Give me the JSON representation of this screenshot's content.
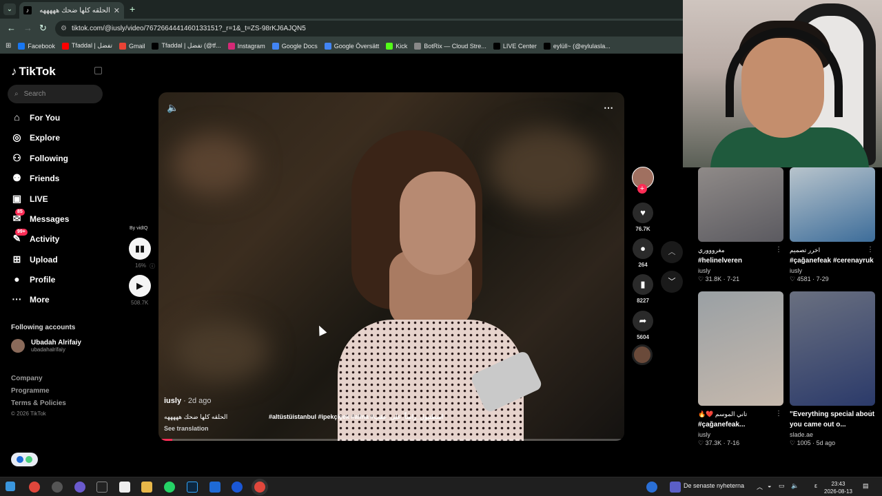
{
  "browser": {
    "tab_title": "الحلقه كلها ضحك هههههه",
    "tab_favicon": "♪",
    "new_tab": "+",
    "url": "tiktok.com/@iusly/video/7672664441460133151?_r=1&_t=ZS-98rKJ6AJQN5",
    "bookmarks": [
      {
        "label": "Facebook",
        "color": "#1877f2"
      },
      {
        "label": "Tfaddal | تفضل",
        "color": "#ff0000"
      },
      {
        "label": "Gmail",
        "color": "#ea4335"
      },
      {
        "label": "Tfaddal | تفضل (@tf...",
        "color": "#000000"
      },
      {
        "label": "Instagram",
        "color": "#d62976"
      },
      {
        "label": "Google Docs",
        "color": "#4285f4"
      },
      {
        "label": "Google Översätt",
        "color": "#4285f4"
      },
      {
        "label": "Kick",
        "color": "#53fc18"
      },
      {
        "label": "BotRix — Cloud Stre...",
        "color": "#888888"
      },
      {
        "label": "LIVE Center",
        "color": "#000000"
      },
      {
        "label": "eylüll~ (@eylulasla...",
        "color": "#000000"
      }
    ]
  },
  "sidebar": {
    "logo": "TikTok",
    "search_placeholder": "Search",
    "nav": [
      {
        "label": "For You",
        "icon": "home-icon",
        "glyph": "⌂"
      },
      {
        "label": "Explore",
        "icon": "compass-icon",
        "glyph": "◎"
      },
      {
        "label": "Following",
        "icon": "following-icon",
        "glyph": "⚇"
      },
      {
        "label": "Friends",
        "icon": "friends-icon",
        "glyph": "⚉"
      },
      {
        "label": "LIVE",
        "icon": "live-icon",
        "glyph": "▣"
      },
      {
        "label": "Messages",
        "icon": "messages-icon",
        "glyph": "✉",
        "badge": "85"
      },
      {
        "label": "Activity",
        "icon": "activity-icon",
        "glyph": "✎",
        "badge": "99+"
      },
      {
        "label": "Upload",
        "icon": "upload-icon",
        "glyph": "⊞"
      },
      {
        "label": "Profile",
        "icon": "profile-icon",
        "glyph": "●"
      },
      {
        "label": "More",
        "icon": "more-icon",
        "glyph": "···"
      }
    ],
    "following_title": "Following accounts",
    "following": {
      "name": "Ubadah Alrifaiy",
      "user": "ubadahalrifaiy"
    },
    "footer": [
      "Company",
      "Programme",
      "Terms & Policies"
    ],
    "copyright": "© 2026 TikTok"
  },
  "widget": {
    "by": "By vidIQ",
    "percent": "16%",
    "views": "508.7K"
  },
  "video": {
    "author": "iusly",
    "ago": " · 2d ago",
    "caption": "الحلقه كلها ضحك هههههه",
    "tags": "#altüstüistanbul #ipekçiçek #alina #اسطنبول_راساً_على_عقب",
    "see_translation": "See translation",
    "progress": 0.03,
    "volume_icon": "volume-icon",
    "more_icon": "more-icon"
  },
  "actions": {
    "likes": "76.7K",
    "comments": "264",
    "saves": "8227",
    "shares": "5604"
  },
  "grid": [
    {
      "caption_rtl": "مغروووري",
      "caption": "#helinelveren #çağanefeak #atayas...",
      "author": "iusly",
      "likes": "31.8K",
      "date": "7-21",
      "tone": [
        "#8f8a88",
        "#5b5a60"
      ]
    },
    {
      "caption_rtl": "اخرر تصميم",
      "caption": "#çağanefeak #cerenayruk #leyla...",
      "author": "iusly",
      "likes": "4581",
      "date": "7-29",
      "tone": [
        "#b8c4cc",
        "#3d6d9a"
      ]
    },
    {
      "caption_rtl": "تاني الموسم ❤️🔥",
      "caption": "#çağanefeak...",
      "author": "iusly",
      "likes": "37.3K",
      "date": "7-16",
      "tone": [
        "#9aa0a4",
        "#c6b9ad"
      ]
    },
    {
      "caption_rtl": "",
      "caption": "\"Everything special about you came out o...",
      "author": "slade.ae",
      "likes": "1005",
      "date": "5d ago",
      "tone": [
        "#6a7080",
        "#2b3a6a"
      ]
    }
  ],
  "taskbar": {
    "news": "De senaste nyheterna",
    "lang": "ε",
    "time": "23:43",
    "date": "2026-08-13"
  }
}
